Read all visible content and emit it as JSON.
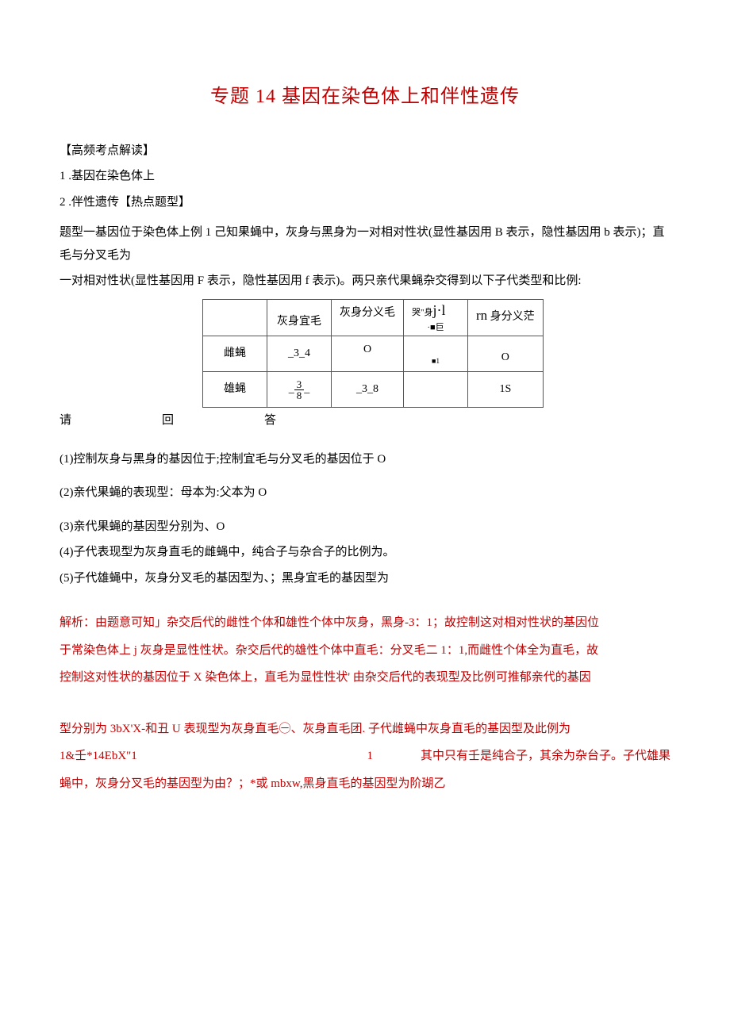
{
  "title": "专题 14 基因在染色体上和伴性遗传",
  "intro_label": "【高频考点解读】",
  "point1": "1 .基因在染色体上",
  "point2": "2 .伴性遗传【热点题型】",
  "stem1": "题型一基因位于染色体上例 1 己知果蝇中，灰身与黑身为一对相对性状(显性基因用 B 表示，隐性基因用 b 表示)；直毛与分叉毛为",
  "stem2": "一对相对性状(显性基因用 F 表示，隐性基因用 f 表示)。两只亲代果蝇杂交得到以下子代类型和比例:",
  "table": {
    "h1": "",
    "h2": "灰身宜毛",
    "h3": "灰身分义毛",
    "h4_top": "哭\"身",
    "h4_jl": "j·l",
    "h4_bot": "·■巨",
    "h5_top": "rn",
    "h5_rest": " 身分义茫",
    "r1c0": "雌蝇",
    "r1c1": "_3_4",
    "r1c2": "O",
    "r1c3": "■1",
    "r1c4": "O",
    "r2c0": "雄蝇",
    "r2c1_num": "3",
    "r2c1_den": "8",
    "r2c2": "_3_8",
    "r2c3": "",
    "r2c4": "1S"
  },
  "please": "请　　回　　答",
  "q1": "(1)控制灰身与黑身的基因位于;控制宜毛与分叉毛的基因位于 O",
  "q2": "(2)亲代果蝇的表现型：母本为:父本为 O",
  "q3": "(3)亲代果蝇的基因型分别为、O",
  "q4": "(4)子代表现型为灰身直毛的雌蝇中，纯合子与杂合子的比例为。",
  "q5": "(5)子代雄蝇中，灰身分叉毛的基因型为、；黑身宜毛的基因型为",
  "exp1": "解析：由题意可知」杂交后代的雌性个体和雄性个体中灰身，黑身-3：1；故控制这对相对性状的基因位",
  "exp2": "于常染色体上 j 灰身是显性性状。杂交后代的雄性个体中直毛：分叉毛二 1：1,而雌性个体全为直毛，故",
  "exp3": "控制这对性状的基因位于 X 染色体上，直毛为显性性状' 由杂交后代的表现型及比例可推郁亲代的基因",
  "exp4a": "型分别为 3bX'X-和丑 U 表现型为灰身直毛㊀、灰身直毛团. 子代雌蝇中灰身直毛的基因型及此例为",
  "exp5a": "1&壬*14EbX\"1",
  "exp5b": "1",
  "exp5c": "其中只有壬是纯合子，其余为杂台子。子代雄果",
  "exp6": "蝇中，灰身分叉毛的基因型为由？；*或 mbxw,黑身直毛的基因型为阶瑚乙"
}
